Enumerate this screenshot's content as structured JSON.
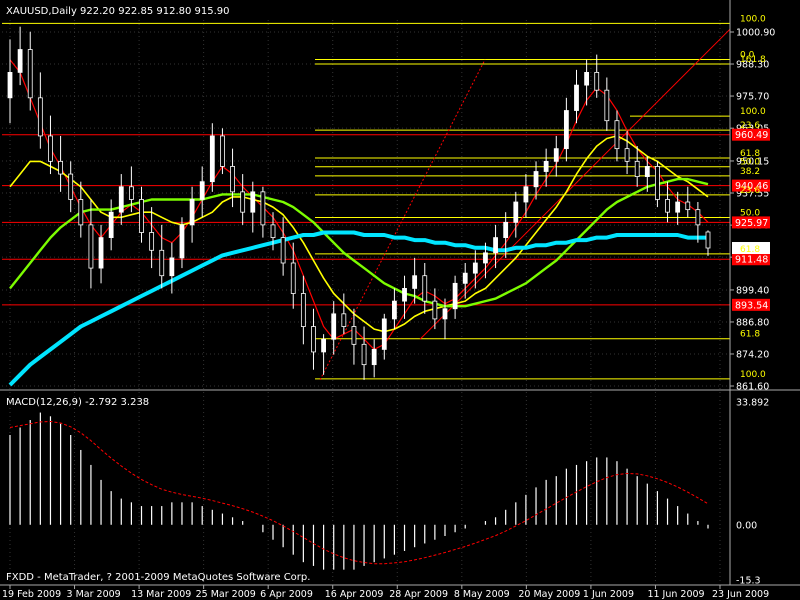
{
  "header": {
    "symbol_line": "XAUUSD,Daily  922.20 922.85 912.80 915.90",
    "macd_line": "MACD(12,26,9) -2.792 3.238",
    "footer": "FXDD - MetaTrader, ? 2001-2009 MetaQuotes Software Corp."
  },
  "colors": {
    "background": "#000000",
    "grid": "#333333",
    "bull_candle": "#ffffff",
    "bear_candle": "#000000",
    "ma_fast": "#ff0000",
    "ma_mid": "#ffff00",
    "ma_slow": "#7cfc00",
    "ma_long": "#00e5ff",
    "fib_line": "#ffff00",
    "level_line": "#ff0000",
    "macd_signal": "#ff0000"
  },
  "chart_data": [
    {
      "type": "candlestick",
      "symbol": "XAUUSD",
      "timeframe": "Daily",
      "ohlc_last": {
        "open": 922.2,
        "high": 922.85,
        "low": 912.8,
        "close": 915.9
      },
      "yticks": [
        "1000.90",
        "988.30",
        "975.70",
        "963.05",
        "950.15",
        "937.55",
        "924.90",
        "912.30",
        "899.40",
        "886.80",
        "874.20",
        "861.60"
      ],
      "ylim": [
        861.6,
        1000.9
      ],
      "xlabels": [
        "19 Feb 2009",
        "3 Mar 2009",
        "13 Mar 2009",
        "25 Mar 2009",
        "6 Apr 2009",
        "16 Apr 2009",
        "28 Apr 2009",
        "8 May 2009",
        "20 May 2009",
        "1 Jun 2009",
        "11 Jun 2009",
        "23 Jun 2009"
      ],
      "price_tags": [
        {
          "text": "960.49",
          "value": 960.49
        },
        {
          "text": "940.46",
          "value": 940.46
        },
        {
          "text": "925.97",
          "value": 925.97
        },
        {
          "text": "911.48",
          "value": 911.48
        },
        {
          "text": "893.54",
          "value": 893.54
        },
        {
          "text": "915.90",
          "value": 915.9
        }
      ],
      "fib_labels": [
        {
          "text": "100.0",
          "value": 1004.3
        },
        {
          "text": "0.0",
          "value": 990.1
        },
        {
          "text": "161.8",
          "value": 988.3
        },
        {
          "text": "100.0",
          "value": 967.8
        },
        {
          "text": "23.6",
          "value": 962.3
        },
        {
          "text": "61.8",
          "value": 951.3
        },
        {
          "text": "50.0",
          "value": 947.9
        },
        {
          "text": "38.2",
          "value": 944.3
        },
        {
          "text": "23.6",
          "value": 936.8
        },
        {
          "text": "50.0",
          "value": 927.9
        },
        {
          "text": "61.8",
          "value": 913.6
        },
        {
          "text": "61.8",
          "value": 880.2
        },
        {
          "text": "100.0",
          "value": 864.4
        }
      ],
      "candles": [
        [
          975,
          998,
          965,
          985
        ],
        [
          985,
          1003,
          980,
          994
        ],
        [
          994,
          1001,
          970,
          975
        ],
        [
          975,
          985,
          955,
          960
        ],
        [
          960,
          968,
          945,
          950
        ],
        [
          950,
          960,
          938,
          945
        ],
        [
          945,
          950,
          930,
          935
        ],
        [
          935,
          942,
          920,
          925
        ],
        [
          925,
          935,
          900,
          908
        ],
        [
          908,
          925,
          902,
          920
        ],
        [
          920,
          935,
          915,
          930
        ],
        [
          930,
          945,
          925,
          940
        ],
        [
          940,
          948,
          930,
          935
        ],
        [
          935,
          940,
          918,
          922
        ],
        [
          922,
          932,
          908,
          915
        ],
        [
          915,
          925,
          900,
          905
        ],
        [
          905,
          918,
          898,
          912
        ],
        [
          912,
          928,
          908,
          925
        ],
        [
          925,
          940,
          918,
          935
        ],
        [
          935,
          948,
          928,
          942
        ],
        [
          942,
          965,
          938,
          960
        ],
        [
          960,
          963,
          945,
          948
        ],
        [
          948,
          955,
          932,
          938
        ],
        [
          938,
          945,
          925,
          930
        ],
        [
          930,
          942,
          922,
          938
        ],
        [
          938,
          940,
          920,
          925
        ],
        [
          925,
          930,
          915,
          920
        ],
        [
          920,
          928,
          905,
          910
        ],
        [
          910,
          918,
          892,
          898
        ],
        [
          898,
          905,
          878,
          885
        ],
        [
          885,
          892,
          868,
          875
        ],
        [
          875,
          882,
          866,
          880
        ],
        [
          880,
          895,
          874,
          890
        ],
        [
          890,
          898,
          882,
          885
        ],
        [
          885,
          892,
          870,
          878
        ],
        [
          878,
          885,
          864,
          870
        ],
        [
          870,
          880,
          865,
          876
        ],
        [
          876,
          890,
          872,
          888
        ],
        [
          888,
          900,
          884,
          895
        ],
        [
          895,
          905,
          888,
          900
        ],
        [
          900,
          912,
          894,
          905
        ],
        [
          905,
          910,
          890,
          895
        ],
        [
          895,
          900,
          884,
          888
        ],
        [
          888,
          896,
          880,
          892
        ],
        [
          892,
          905,
          888,
          902
        ],
        [
          902,
          910,
          896,
          906
        ],
        [
          906,
          915,
          900,
          910
        ],
        [
          910,
          918,
          904,
          914
        ],
        [
          914,
          925,
          908,
          920
        ],
        [
          920,
          930,
          912,
          926
        ],
        [
          926,
          938,
          920,
          934
        ],
        [
          934,
          945,
          928,
          940
        ],
        [
          940,
          950,
          935,
          946
        ],
        [
          946,
          955,
          940,
          950
        ],
        [
          950,
          960,
          944,
          955
        ],
        [
          955,
          975,
          950,
          970
        ],
        [
          970,
          986,
          965,
          980
        ],
        [
          980,
          990,
          972,
          985
        ],
        [
          985,
          992,
          975,
          978
        ],
        [
          978,
          983,
          962,
          966
        ],
        [
          966,
          970,
          950,
          955
        ],
        [
          955,
          962,
          945,
          950
        ],
        [
          950,
          956,
          940,
          944
        ],
        [
          944,
          952,
          938,
          948
        ],
        [
          948,
          950,
          932,
          935
        ],
        [
          935,
          942,
          926,
          930
        ],
        [
          930,
          938,
          925,
          934
        ],
        [
          934,
          940,
          928,
          931
        ],
        [
          931,
          934,
          918,
          925
        ],
        [
          922.2,
          922.85,
          912.8,
          915.9
        ]
      ],
      "moving_averages": [
        {
          "color_key": "ma_fast",
          "values": [
            990,
            985,
            975,
            965,
            955,
            948,
            940,
            932,
            925,
            920,
            925,
            930,
            933,
            930,
            925,
            920,
            918,
            922,
            928,
            935,
            942,
            948,
            945,
            940,
            936,
            932,
            928,
            922,
            915,
            905,
            895,
            885,
            880,
            882,
            884,
            880,
            876,
            878,
            884,
            890,
            896,
            899,
            897,
            894,
            896,
            900,
            904,
            908,
            913,
            918,
            924,
            930,
            937,
            943,
            949,
            957,
            966,
            974,
            979,
            976,
            970,
            962,
            955,
            950,
            946,
            940,
            935,
            933,
            930,
            926
          ]
        },
        {
          "color_key": "ma_mid",
          "values": [
            940,
            945,
            950,
            950,
            948,
            946,
            943,
            940,
            935,
            930,
            928,
            928,
            929,
            930,
            930,
            928,
            926,
            925,
            926,
            928,
            930,
            934,
            936,
            936,
            935,
            934,
            932,
            929,
            924,
            918,
            911,
            904,
            898,
            894,
            890,
            887,
            884,
            883,
            884,
            886,
            889,
            891,
            892,
            893,
            894,
            895,
            898,
            900,
            904,
            908,
            912,
            917,
            922,
            927,
            932,
            938,
            945,
            951,
            956,
            959,
            960,
            958,
            955,
            952,
            950,
            947,
            944,
            942,
            939,
            936
          ]
        },
        {
          "color_key": "ma_slow",
          "values": [
            900,
            905,
            910,
            915,
            920,
            924,
            927,
            930,
            931,
            931,
            931,
            932,
            933,
            934,
            935,
            935,
            935,
            935,
            935,
            935,
            936,
            937,
            937,
            937,
            937,
            936,
            935,
            934,
            932,
            929,
            926,
            922,
            918,
            914,
            911,
            908,
            905,
            902,
            900,
            898,
            897,
            895,
            894,
            893,
            893,
            893,
            894,
            895,
            896,
            898,
            900,
            902,
            905,
            908,
            911,
            915,
            919,
            923,
            927,
            931,
            934,
            936,
            938,
            940,
            941,
            942,
            943,
            943,
            942,
            941
          ]
        },
        {
          "color_key": "ma_long",
          "values": [
            862,
            866,
            870,
            873,
            876,
            879,
            882,
            885,
            887,
            889,
            891,
            893,
            895,
            897,
            899,
            901,
            903,
            905,
            907,
            909,
            911,
            913,
            914,
            915,
            916,
            917,
            918,
            919,
            920,
            921,
            921,
            922,
            922,
            922,
            922,
            921,
            921,
            921,
            920,
            920,
            919,
            919,
            918,
            918,
            917,
            917,
            916,
            916,
            915,
            915,
            916,
            916,
            917,
            917,
            918,
            918,
            919,
            919,
            920,
            920,
            921,
            921,
            921,
            921,
            921,
            921,
            921,
            920,
            920,
            920
          ]
        }
      ]
    },
    {
      "type": "bar",
      "name": "MACD(12,26,9)",
      "yticks": [
        "33.892",
        "0.00",
        "-15.3"
      ],
      "ylim": [
        -15.3,
        33.892
      ],
      "histogram": [
        24,
        26,
        28,
        30,
        29,
        27,
        24,
        20,
        16,
        12,
        9,
        7,
        6,
        5,
        5,
        5,
        6,
        6,
        6,
        5,
        4,
        3,
        2,
        1,
        0,
        -2,
        -4,
        -6,
        -8,
        -10,
        -11,
        -12,
        -12,
        -12,
        -12,
        -11,
        -10,
        -9,
        -8,
        -7,
        -6,
        -5,
        -4,
        -3,
        -2,
        -1,
        0,
        1,
        2,
        4,
        6,
        8,
        10,
        12,
        13,
        15,
        16,
        17,
        18,
        18,
        17,
        15,
        13,
        11,
        9,
        7,
        5,
        3,
        1,
        -1
      ],
      "signal": [
        26,
        26.5,
        27,
        27.5,
        27.6,
        27.2,
        26.2,
        24.6,
        22.5,
        20.1,
        17.8,
        15.7,
        13.8,
        12.1,
        10.7,
        9.5,
        8.7,
        8.1,
        7.6,
        7.1,
        6.5,
        5.8,
        5.1,
        4.3,
        3.4,
        2.3,
        1.1,
        -0.3,
        -1.8,
        -3.4,
        -5,
        -6.5,
        -7.8,
        -8.8,
        -9.6,
        -10.1,
        -10.4,
        -10.4,
        -10.2,
        -9.9,
        -9.4,
        -8.8,
        -8.1,
        -7.4,
        -6.6,
        -5.8,
        -4.9,
        -3.9,
        -2.9,
        -1.7,
        -0.3,
        1.1,
        2.7,
        4.2,
        5.8,
        7.3,
        8.8,
        10.2,
        11.5,
        12.6,
        13.4,
        13.7,
        13.6,
        13.1,
        12.3,
        11.3,
        10.1,
        8.7,
        7.2,
        5.6
      ]
    }
  ]
}
